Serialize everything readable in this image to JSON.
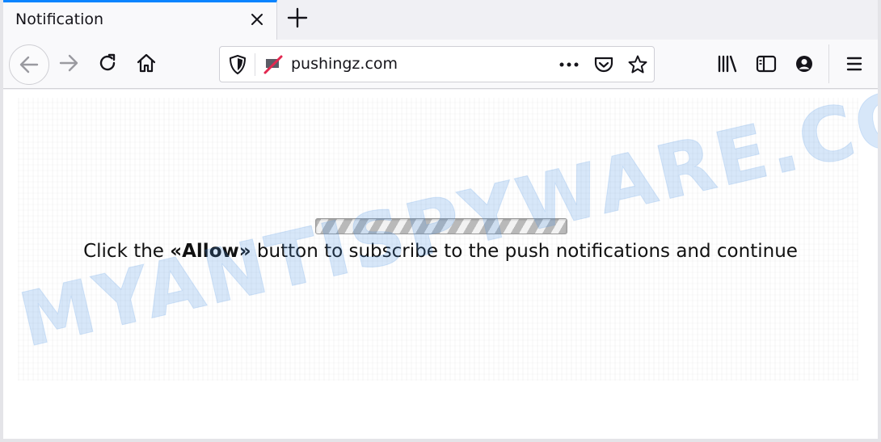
{
  "tab": {
    "title": "Notification"
  },
  "urlbar": {
    "url": "pushingz.com"
  },
  "page": {
    "message_before": "Click the ",
    "message_bold": "«Allow»",
    "message_after": " button to subscribe to the push notifications and continue"
  },
  "watermark": {
    "text": "MYANTISPYWARE.COM"
  },
  "icons": {
    "tab_close": "close-icon",
    "new_tab": "plus-icon",
    "back": "back-arrow-icon",
    "forward": "forward-arrow-icon",
    "reload": "reload-icon",
    "home": "home-icon",
    "tracking": "shield-icon",
    "notifications_blocked": "notification-blocked-icon",
    "page_actions": "more-dots-icon",
    "pocket": "pocket-icon",
    "bookmark": "star-icon",
    "library": "library-icon",
    "sidebar": "sidebar-icon",
    "account": "account-icon",
    "menu": "hamburger-menu-icon"
  },
  "colors": {
    "accent": "#0a84ff",
    "watermark": "#4a90e2"
  }
}
